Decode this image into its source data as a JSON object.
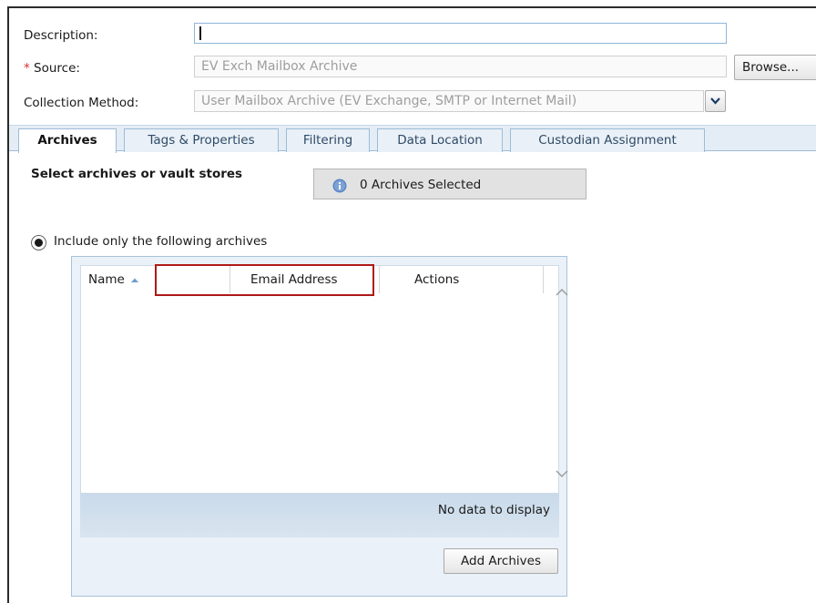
{
  "form": {
    "description_label": "Description:",
    "description_value": "",
    "source_required_mark": "*",
    "source_label": "Source:",
    "source_value": "EV Exch Mailbox Archive",
    "browse_label": "Browse...",
    "collection_label": "Collection Method:",
    "collection_value": "User Mailbox Archive (EV Exchange, SMTP or Internet Mail)"
  },
  "tabs": [
    {
      "label": "Archives",
      "active": true
    },
    {
      "label": "Tags & Properties",
      "active": false
    },
    {
      "label": "Filtering",
      "active": false
    },
    {
      "label": "Data Location",
      "active": false
    },
    {
      "label": "Custodian Assignment",
      "active": false
    }
  ],
  "archives": {
    "section_title": "Select archives or vault stores",
    "selected_status": "0 Archives Selected",
    "radio_label": "Include only the following archives",
    "radio_checked": true,
    "columns": [
      "Name",
      "Email Address",
      "Actions"
    ],
    "sort_column": "Name",
    "sort_direction": "ascending",
    "empty_message": "No data to display",
    "add_button": "Add Archives"
  },
  "icons": {
    "info": "info-icon",
    "dropdown": "chevron-down-icon",
    "sort": "sort-ascending-icon",
    "scroll_up": "chevron-up-icon",
    "scroll_down": "chevron-down-icon"
  },
  "colors": {
    "required": "#d32f2f",
    "highlight_border": "#b01818",
    "tab_active_text": "#111111",
    "tab_text": "#2e4a66",
    "info_blue": "#5a86c4"
  }
}
